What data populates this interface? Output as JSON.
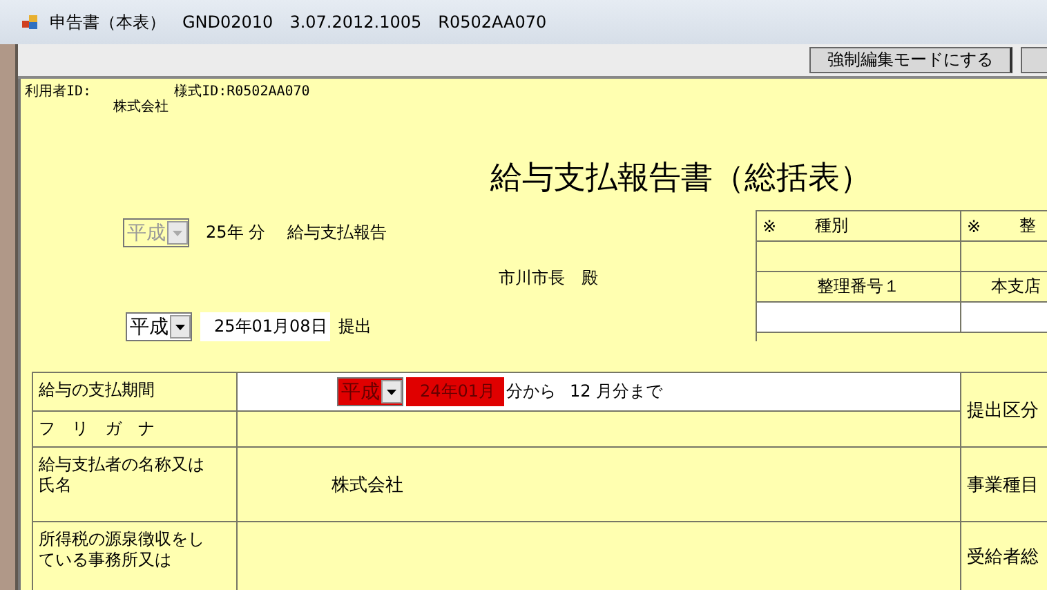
{
  "window": {
    "title": "申告書（本表）　GND02010　3.07.2012.1005　R0502AA070"
  },
  "toolbar": {
    "buttons": [
      {
        "label": "強制編集モードにする"
      }
    ]
  },
  "header": {
    "user_id_label": "利用者ID:",
    "form_id": "様式ID:R0502AA070",
    "company": "株式会社"
  },
  "title": "給与支払報告書（総括表）",
  "year_line": {
    "era": {
      "value": "平成",
      "disabled": true,
      "invalid": false
    },
    "year": "25年 分",
    "caption": "給与支払報告"
  },
  "addressee": "市川市長　殿",
  "submit_line": {
    "era": {
      "value": "平成",
      "disabled": false,
      "invalid": false
    },
    "date": "25年01月08日",
    "suffix": "提出"
  },
  "ref_table": {
    "headers": [
      {
        "mark": "※",
        "label": "種別"
      },
      {
        "mark": "※",
        "label": "整"
      }
    ],
    "labels": [
      "整理番号１",
      "本支店"
    ]
  },
  "main_table": {
    "rows": [
      {
        "kind": "period",
        "label": "給与の支払期間",
        "era": {
          "value": "平成",
          "invalid": true
        },
        "from": {
          "value": "24年01月",
          "invalid": true
        },
        "from_suffix": "分から",
        "to": "12 月分まで"
      },
      {
        "kind": "text",
        "label": "フ　リ　ガ　ナ"
      },
      {
        "kind": "text",
        "label": "給与支払者の名称又は氏名",
        "value": "株式会社"
      },
      {
        "kind": "text",
        "label": "所得税の源泉徴収をしている事務所又は"
      }
    ],
    "side_labels": [
      "提出区分",
      "事業種目",
      "受給者総"
    ]
  }
}
